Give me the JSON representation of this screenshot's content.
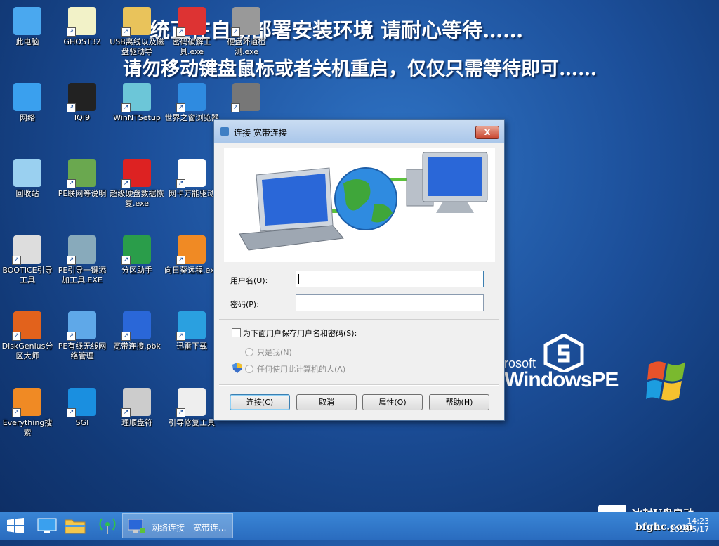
{
  "banner": {
    "line1": "统正在自动部署安装环境 请耐心等待……",
    "line2": "请勿移动键盘鼠标或者关机重启，仅仅只需等待即可……"
  },
  "desktop_icons": [
    {
      "label": "此电脑",
      "icon": "computer-icon"
    },
    {
      "label": "GHOST32",
      "icon": "ghost-icon"
    },
    {
      "label": "USB离线以及磁盘驱动导",
      "icon": "zip-folder-icon"
    },
    {
      "label": "密码破解工具.exe",
      "icon": "ntpwedit-icon"
    },
    {
      "label": "硬盘坏道检测.exe",
      "icon": "disk-check-icon"
    },
    {
      "label": "网络",
      "icon": "network-icon"
    },
    {
      "label": "IQI9",
      "icon": "windows-flag-icon"
    },
    {
      "label": "WinNTSetup",
      "icon": "setup-icon"
    },
    {
      "label": "世界之窗浏览器",
      "icon": "browser-globe-icon"
    },
    {
      "label": "",
      "icon": "hard-disk-icon"
    },
    {
      "label": "回收站",
      "icon": "recycle-bin-icon"
    },
    {
      "label": "PE联网等说明",
      "icon": "pdf-icon"
    },
    {
      "label": "超级硬盘数据恢复.exe",
      "icon": "first-aid-icon"
    },
    {
      "label": "网卡万能驱动",
      "icon": "wan-driver-icon"
    },
    {
      "label": "BOOTICE引导工具",
      "icon": "bootice-icon"
    },
    {
      "label": "PE引导一键添加工具.EXE",
      "icon": "pe-boot-icon"
    },
    {
      "label": "分区助手",
      "icon": "partition-assistant-icon"
    },
    {
      "label": "向日葵远程.exe",
      "icon": "sunflower-icon"
    },
    {
      "label": "DiskGenius分区大师",
      "icon": "diskgenius-icon"
    },
    {
      "label": "PE有线无线网络管理",
      "icon": "network-manager-icon"
    },
    {
      "label": "宽带连接.pbk",
      "icon": "broadband-icon"
    },
    {
      "label": "迅雷下载",
      "icon": "thunder-icon"
    },
    {
      "label": "Everything搜索",
      "icon": "search-magnifier-icon"
    },
    {
      "label": "SGI",
      "icon": "sgi-icon"
    },
    {
      "label": "理顺盘符",
      "icon": "gear-doc-icon"
    },
    {
      "label": "引导修复工具",
      "icon": "repair-tool-icon"
    }
  ],
  "dialog": {
    "title": "连接 宽带连接",
    "close_label": "X",
    "username_label": "用户名(U):",
    "username_value": "",
    "password_label": "密码(P):",
    "password_value": "",
    "save_checkbox_label": "为下面用户保存用户名和密码(S):",
    "save_checked": false,
    "radio_me": "只是我(N)",
    "radio_anyone": "任何使用此计算机的人(A)",
    "buttons": {
      "connect": "连接(C)",
      "cancel": "取消",
      "properties": "属性(O)",
      "help": "帮助(H)"
    }
  },
  "taskbar": {
    "active_item": "网络连接 - 宽带连...",
    "time": "14:23",
    "date": "2018/5/17"
  },
  "branding": {
    "winpe_line1": "rosoft",
    "winpe_line2": "WindowsPE",
    "watermark_line1": "冰封U盘启动",
    "watermark_line2": "bfghc.com"
  },
  "colors": {
    "desktop": "#1c4f9a",
    "taskbar": "#2f76c9",
    "close_button": "#c9462f"
  }
}
